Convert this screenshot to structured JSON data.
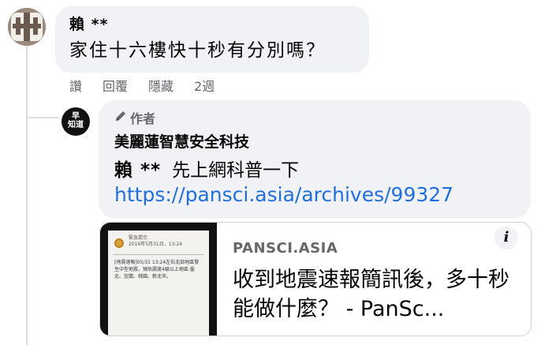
{
  "comment": {
    "author": "賴 **",
    "text": "家住十六樓快十秒有分別嗎？",
    "actions": {
      "like": "讚",
      "reply": "回覆",
      "hide": "隱藏",
      "time": "2週"
    }
  },
  "reply": {
    "avatar_text_line1": "早",
    "avatar_text_line2": "知道",
    "badge": "作者",
    "author": "美麗蓮智慧安全科技",
    "mention": "賴 **",
    "text": "先上網科普一下",
    "link": "https://pansci.asia/archives/99327",
    "preview": {
      "domain": "PANSCI.ASIA",
      "title": "收到地震速報簡訊後，多十秒能做什麼？ - PanSc...",
      "thumbnail": {
        "header_line1": "緊急提示",
        "header_line2": "2016年5月31日，13:24",
        "message": "[地震速報]05/31 13:24左右北部地區發生中型地震，預估震度4級以上地區:臺北、宜蘭、桃園、新北市。"
      }
    }
  },
  "icons": {
    "pen": "pencil-icon",
    "info": "info-icon"
  },
  "colors": {
    "link": "#216fdb",
    "bubble": "#f0f2f5",
    "muted": "#65676b"
  }
}
